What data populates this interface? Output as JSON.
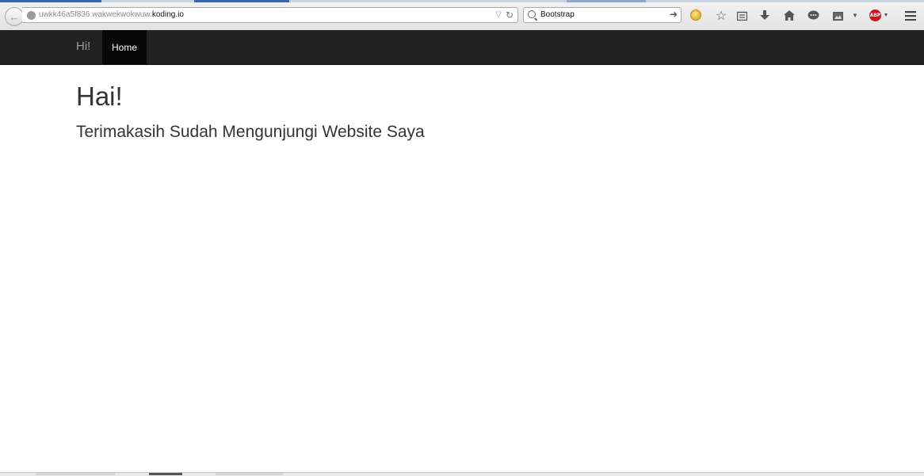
{
  "browser": {
    "url_host_muted": "uwkk46a5f836.wakwekwokwuw.",
    "url_host_domain": "koding.io",
    "search_value": "Bootstrap",
    "abp_label": "ABP",
    "icons": [
      "back-arrow-icon",
      "globe-icon",
      "dropdown-icon",
      "reload-icon",
      "search-icon",
      "go-arrow-icon",
      "extension-smiley-icon",
      "star-icon",
      "reading-list-icon",
      "download-icon",
      "home-icon",
      "chat-icon",
      "screenshot-icon",
      "menu-dropdown-icon",
      "adblock-icon",
      "hamburger-menu-icon"
    ]
  },
  "navbar": {
    "brand": "Hi!",
    "items": [
      {
        "label": "Home",
        "active": true
      }
    ],
    "bg_color": "#222222",
    "active_bg_color": "#080808"
  },
  "main": {
    "heading": "Hai!",
    "lead": "Terimakasih Sudah Mengunjungi Website Saya"
  },
  "colors": {
    "text": "#333333",
    "abp": "#c9161d"
  }
}
